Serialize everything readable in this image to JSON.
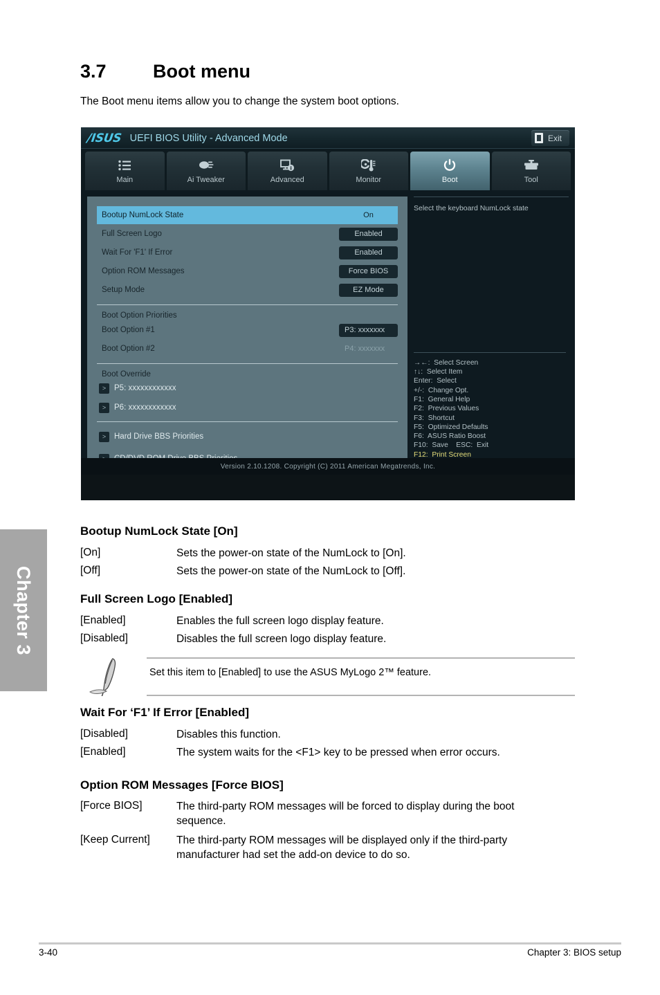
{
  "chapter_tab": "Chapter 3",
  "heading": {
    "number": "3.7",
    "title": "Boot menu",
    "intro": "The Boot menu items allow you to change the system boot options."
  },
  "bios": {
    "logo": "/ISUS",
    "title": "UEFI BIOS Utility - Advanced Mode",
    "exit_label": "Exit",
    "tabs": [
      {
        "label": "Main",
        "icon": "list-icon",
        "active": false
      },
      {
        "label": "Ai  Tweaker",
        "icon": "tweaker-icon",
        "active": false
      },
      {
        "label": "Advanced",
        "icon": "monitor-info-icon",
        "active": false
      },
      {
        "label": "Monitor",
        "icon": "thermometer-icon",
        "active": false
      },
      {
        "label": "Boot",
        "icon": "power-icon",
        "active": true
      },
      {
        "label": "Tool",
        "icon": "toolbox-icon",
        "active": false
      }
    ],
    "settings": [
      {
        "label": "Bootup NumLock State",
        "value": "On",
        "selected": true
      },
      {
        "label": "Full Screen Logo",
        "value": "Enabled",
        "selected": false
      },
      {
        "label": "Wait For 'F1' If Error",
        "value": "Enabled",
        "selected": false
      },
      {
        "label": "Option ROM Messages",
        "value": "Force BIOS",
        "selected": false
      },
      {
        "label": "Setup Mode",
        "value": "EZ Mode",
        "selected": false
      }
    ],
    "boot_priorities": {
      "group_title": "Boot Option Priorities",
      "items": [
        {
          "label": "Boot Option #1",
          "value": "P3:  xxxxxxx",
          "style": "pill"
        },
        {
          "label": "Boot Option #2",
          "value": "P4:  xxxxxxx",
          "style": "plain"
        }
      ]
    },
    "boot_override": {
      "group_title": "Boot Override",
      "items": [
        {
          "arrow": ">",
          "label": "P5:  xxxxxxxxxxxx"
        },
        {
          "arrow": ">",
          "label": "P6:  xxxxxxxxxxxx"
        }
      ]
    },
    "bbs_links": [
      {
        "arrow": ">",
        "label": "Hard Drive BBS Priorities"
      },
      {
        "arrow": ">",
        "label": "CD/DVD ROM Drive BBS Priorities"
      }
    ],
    "help": {
      "description": "Select the keyboard NumLock state",
      "keys": [
        {
          "text": "→←:  Select Screen",
          "accent": false
        },
        {
          "text": "↑↓:  Select Item",
          "accent": false
        },
        {
          "text": "Enter:  Select",
          "accent": false
        },
        {
          "text": "+/-:  Change Opt.",
          "accent": false
        },
        {
          "text": "F1:  General Help",
          "accent": false
        },
        {
          "text": "F2:  Previous Values",
          "accent": false
        },
        {
          "text": "F3:  Shortcut",
          "accent": false
        },
        {
          "text": "F5:  Optimized Defaults",
          "accent": false
        },
        {
          "text": "F6:  ASUS Ratio Boost",
          "accent": false
        },
        {
          "text": "F10:  Save    ESC:  Exit",
          "accent": false
        },
        {
          "text": "F12:  Print Screen",
          "accent": true
        }
      ]
    },
    "footer": "Version  2.10.1208.   Copyright  (C)  2011  American  Megatrends,  Inc."
  },
  "sections": [
    {
      "title": "Bootup NumLock State [On]",
      "rows": [
        {
          "term": "[On]",
          "desc": "Sets the power-on state of the NumLock to [On]."
        },
        {
          "term": "[Off]",
          "desc": "Sets the power-on state of the NumLock to [Off]."
        }
      ]
    },
    {
      "title": "Full Screen Logo [Enabled]",
      "rows": [
        {
          "term": "[Enabled]",
          "desc": "Enables the full screen logo display feature."
        },
        {
          "term": "[Disabled]",
          "desc": "Disables the full screen logo display feature."
        }
      ]
    },
    {
      "title": "Wait For ‘F1’ If Error [Enabled]",
      "rows": [
        {
          "term": "[Disabled]",
          "desc": "Disables this function."
        },
        {
          "term": "[Enabled]",
          "desc": "The system waits for the <F1> key to be pressed when error occurs."
        }
      ]
    },
    {
      "title": "Option ROM Messages [Force BIOS]",
      "rows": [
        {
          "term": "[Force BIOS]",
          "desc": "The third-party ROM messages will be forced to display during the boot sequence."
        },
        {
          "term": "[Keep Current]",
          "desc": "The third-party ROM messages will be displayed only if the third-party manufacturer had set the add-on device to do so."
        }
      ]
    }
  ],
  "note": {
    "text": "Set this item to [Enabled] to use the ASUS MyLogo 2™ feature."
  },
  "page_footer": {
    "page_number": "3-40",
    "right_text": "Chapter 3: BIOS setup"
  },
  "colors": {
    "accent_blue": "#63b9dd",
    "pane_bg": "#5d757e",
    "bios_bg": "#0e1a20",
    "key_accent": "#e4dd7a"
  }
}
